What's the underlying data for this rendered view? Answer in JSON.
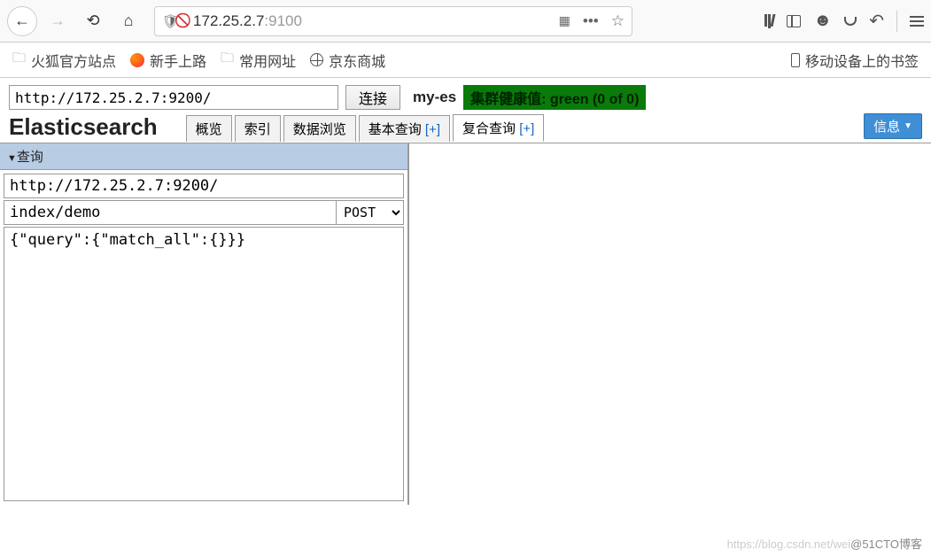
{
  "browser": {
    "url_host": "172.25.2.7",
    "url_port": ":9100"
  },
  "bookmarks": {
    "ff_official": "火狐官方站点",
    "getting_started": "新手上路",
    "common_urls": "常用网址",
    "jd_mall": "京东商城",
    "mobile_bookmarks": "移动设备上的书签"
  },
  "es": {
    "connect_url": "http://172.25.2.7:9200/",
    "connect_btn": "连接",
    "cluster_name": "my-es",
    "health_text": "集群健康值: green (0 of 0)",
    "app_title": "Elasticsearch",
    "tabs": {
      "overview": "概览",
      "indices": "索引",
      "browser": "数据浏览",
      "basic_query": "基本查询",
      "compound_query": "复合查询",
      "plus": "[+]"
    },
    "info_btn": "信息",
    "query": {
      "header": "查询",
      "server": "http://172.25.2.7:9200/",
      "path": "index/demo",
      "method": "POST",
      "body": "{\"query\":{\"match_all\":{}}}"
    }
  },
  "watermark": {
    "faint": "https://blog.csdn.net/wei",
    "visible": "@51CTO博客"
  }
}
